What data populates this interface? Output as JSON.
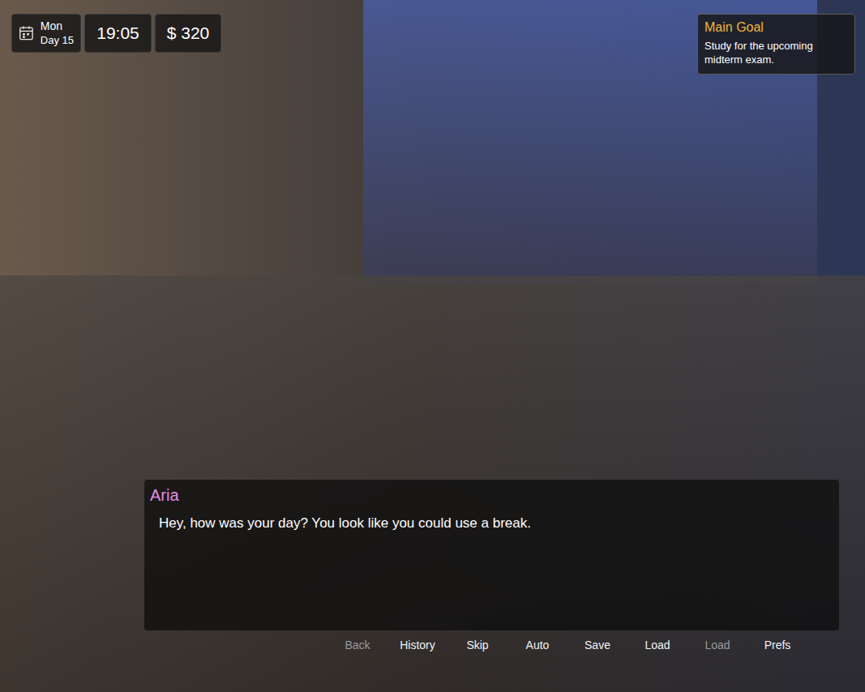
{
  "hud": {
    "weekday": "Mon",
    "day": "Day 15",
    "time": "19:05",
    "money": "$ 320"
  },
  "goal": {
    "title": "Main Goal",
    "text": "Study for the upcoming midterm exam."
  },
  "dialogue": {
    "speaker": "Aria",
    "text": "Hey, how was your day? You look like you could use a break."
  },
  "quick_menu": [
    {
      "label": "Back",
      "disabled": true
    },
    {
      "label": "History",
      "disabled": false
    },
    {
      "label": "Skip",
      "disabled": false
    },
    {
      "label": "Auto",
      "disabled": false
    },
    {
      "label": "Save",
      "disabled": false
    },
    {
      "label": "Load",
      "disabled": false
    },
    {
      "label": "Load",
      "disabled": true
    },
    {
      "label": "Prefs",
      "disabled": false
    }
  ]
}
